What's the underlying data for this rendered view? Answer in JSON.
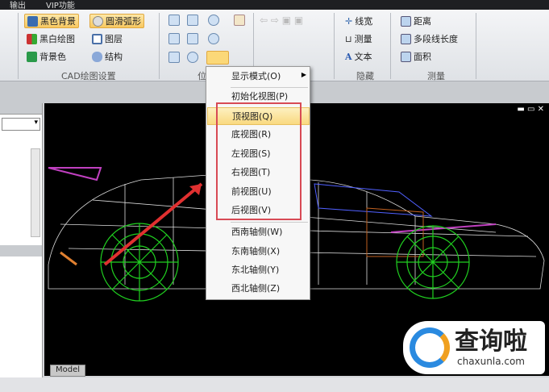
{
  "menubar": {
    "items": [
      "输出",
      "VIP功能"
    ]
  },
  "ribbon": {
    "cad_settings": {
      "label": "CAD绘图设置",
      "buttons": [
        "黑色背景",
        "圆滑弧形",
        "黑白绘图",
        "图层",
        "背景色",
        "结构"
      ]
    },
    "position": {
      "label": "位"
    },
    "hide": {
      "label": "隐藏",
      "buttons": [
        "线宽",
        "测量",
        "文本"
      ]
    },
    "measure": {
      "label": "测量",
      "buttons": [
        "距离",
        "多段线长度",
        "面积"
      ]
    }
  },
  "context_menu": {
    "items": [
      "显示模式(O)",
      "初始化视图(P)",
      "顶视图(Q)",
      "底视图(R)",
      "左视图(S)",
      "右视图(T)",
      "前视图(U)",
      "后视图(V)",
      "西南轴侧(W)",
      "东南轴侧(X)",
      "东北轴侧(Y)",
      "西北轴侧(Z)"
    ],
    "highlighted": "顶视图(Q)"
  },
  "canvas": {
    "tab": "Model"
  },
  "watermark": {
    "brand": "查询啦",
    "url": "chaxunla.com"
  }
}
